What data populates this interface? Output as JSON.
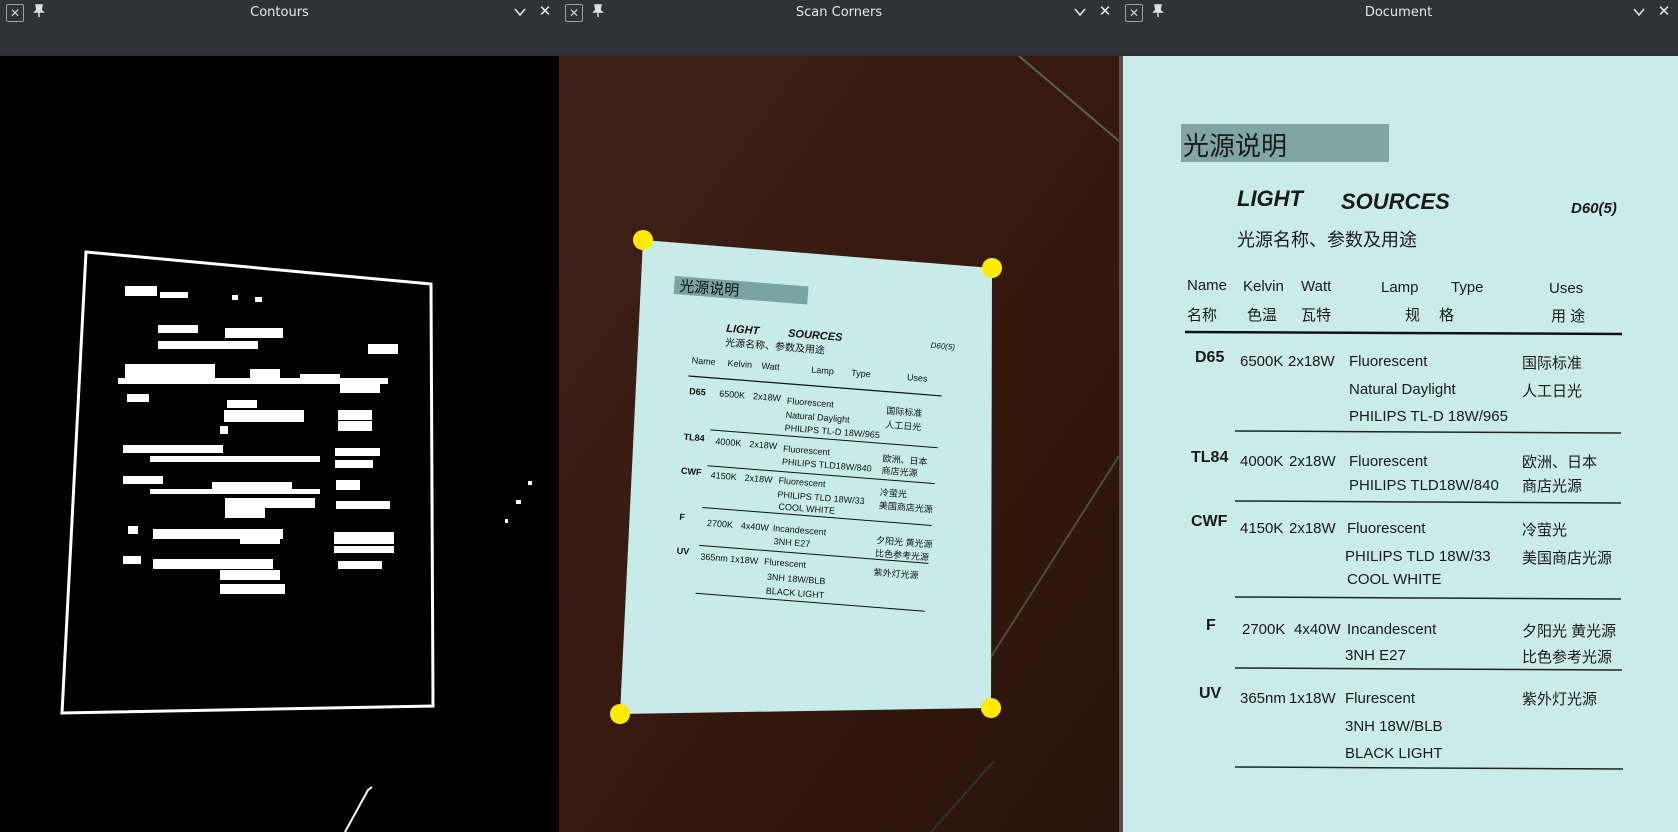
{
  "windows": [
    {
      "title": "Contours"
    },
    {
      "title": "Scan Corners"
    },
    {
      "title": "Document"
    }
  ],
  "colors": {
    "corner_marker": "#ffeb00",
    "paper": "#c9ecea",
    "header_band": "#7fa5a5",
    "table_wood": "#3d1f17"
  },
  "doc": {
    "header_cn": "光源说明",
    "title_light": "LIGHT",
    "title_sources": "SOURCES",
    "code": "D60(5)",
    "subtitle_cn": "光源名称、参数及用途",
    "cols_en": [
      "Name",
      "Kelvin",
      "Watt",
      "Lamp",
      "Type",
      "Uses"
    ],
    "cols_cn": [
      "名称",
      "色温",
      "瓦特",
      "规",
      "格",
      "用 途"
    ],
    "rows": [
      {
        "name": "D65",
        "kelvin": "6500K",
        "watt": "2x18W",
        "lamp": [
          "Fluorescent",
          "Natural   Daylight",
          "PHILIPS  TL-D 18W/965"
        ],
        "uses": [
          "国际标准",
          "人工日光"
        ]
      },
      {
        "name": "TL84",
        "kelvin": "4000K",
        "watt": "2x18W",
        "lamp": [
          "Fluorescent",
          "PHILIPS TLD18W/840"
        ],
        "uses": [
          "欧洲、日本",
          "商店光源"
        ]
      },
      {
        "name": "CWF",
        "kelvin": "4150K",
        "watt": "2x18W",
        "lamp": [
          "Fluorescent",
          "PHILIPS  TLD 18W/33",
          "COOL   WHITE"
        ],
        "uses": [
          "冷萤光",
          "美国商店光源"
        ]
      },
      {
        "name": "F",
        "kelvin": "2700K",
        "watt": "4x40W",
        "lamp": [
          "Incandescent",
          "3NH  E27"
        ],
        "uses": [
          "夕阳光  黄光源",
          "比色参考光源"
        ]
      },
      {
        "name": "UV",
        "kelvin": "365nm",
        "watt": "1x18W",
        "lamp": [
          "Flurescent",
          "3NH 18W/BLB",
          "BLACK  LIGHT"
        ],
        "uses": [
          "紫外灯光源"
        ]
      }
    ]
  }
}
